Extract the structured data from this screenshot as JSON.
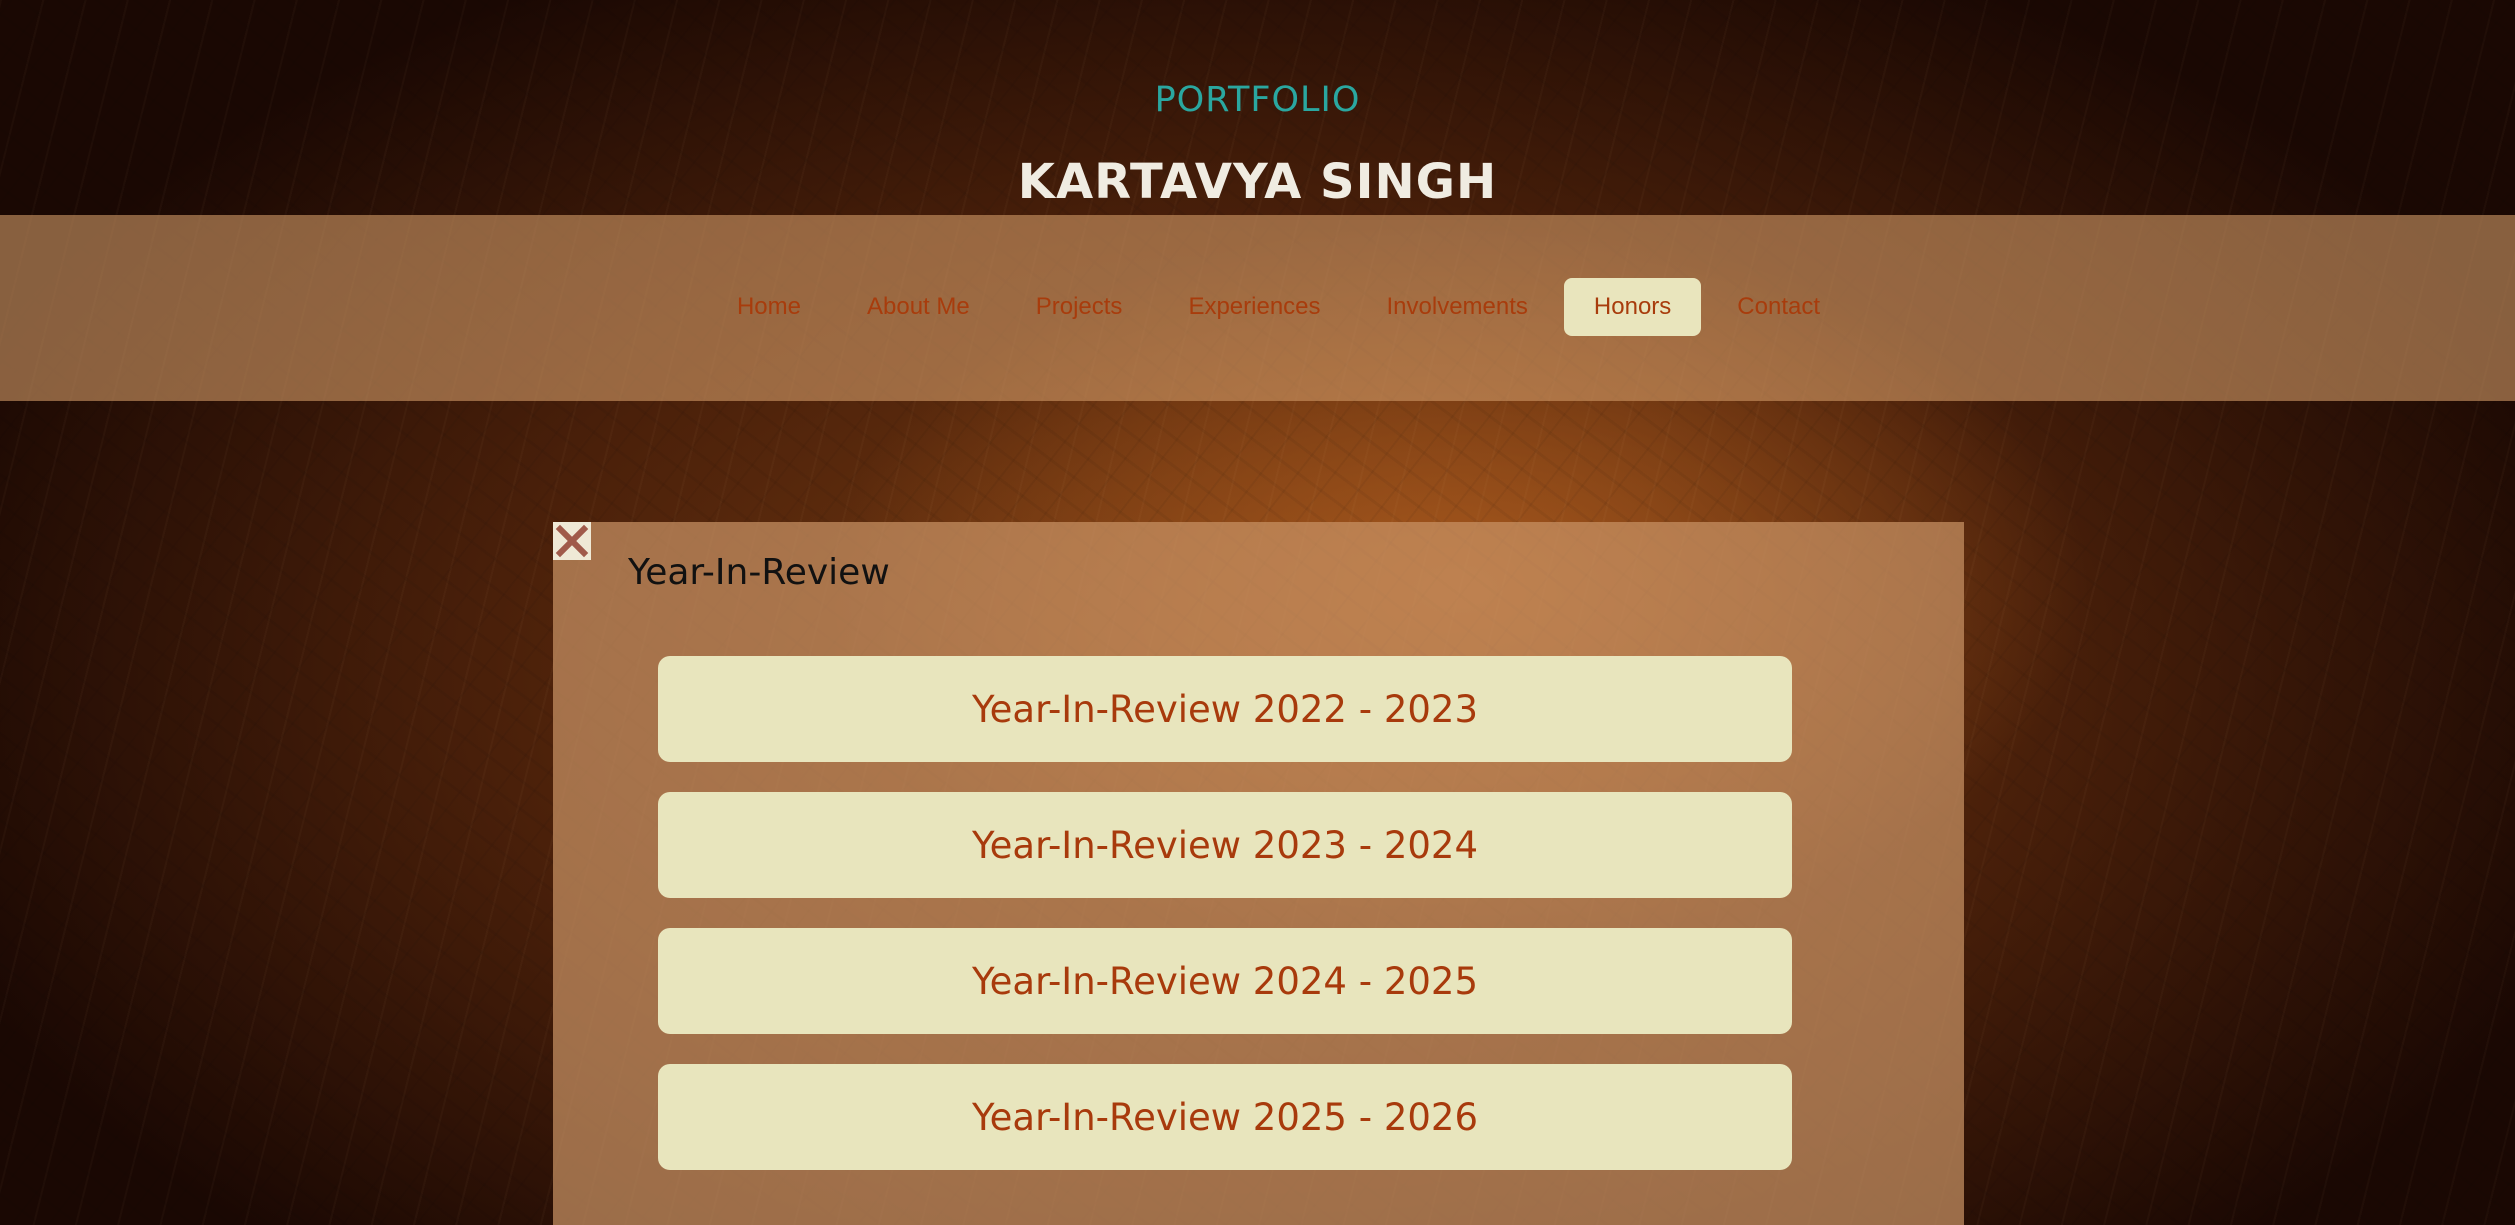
{
  "header": {
    "eyebrow": "PORTFOLIO",
    "name": "KARTAVYA SINGH"
  },
  "nav": {
    "items": [
      {
        "label": "Home"
      },
      {
        "label": "About Me"
      },
      {
        "label": "Projects"
      },
      {
        "label": "Experiences"
      },
      {
        "label": "Involvements"
      },
      {
        "label": "Honors",
        "active": true
      },
      {
        "label": "Contact"
      }
    ]
  },
  "panel": {
    "title": "Year-In-Review",
    "close_icon": "close-x-icon",
    "items": [
      {
        "label": "Year-In-Review 2022 - 2023"
      },
      {
        "label": "Year-In-Review 2023 - 2024"
      },
      {
        "label": "Year-In-Review 2024 - 2025"
      },
      {
        "label": "Year-In-Review 2025 - 2026"
      }
    ]
  },
  "colors": {
    "eyebrow": "#2aa7a0",
    "nav_text": "#a83c0c",
    "active_bg": "#e9e5bd",
    "button_bg": "#e8e5bd",
    "button_text": "#a83a0c",
    "close_x": "#a05a4a"
  }
}
